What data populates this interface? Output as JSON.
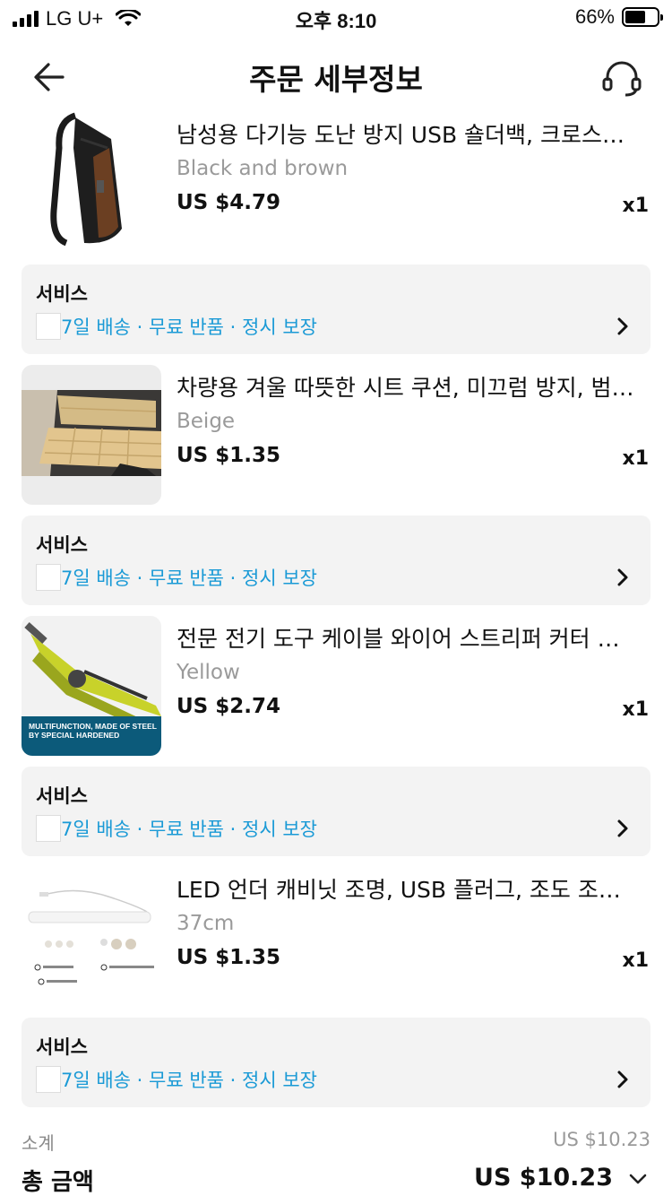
{
  "status_bar": {
    "carrier": "LG U+",
    "time": "오후 8:10",
    "battery_pct": "66%",
    "battery_level": 0.66
  },
  "header": {
    "title": "주문 세부정보",
    "back_icon": "arrow-left-icon",
    "support_icon": "headset-icon"
  },
  "items": [
    {
      "title": "남성용 다기능 도난 방지 USB 숄더백, 크로스바디 백",
      "variant": "Black and brown",
      "price": "US $4.79",
      "qty": "x1"
    },
    {
      "title": "차량용 겨울 따뜻한 시트 쿠션, 미끄럼 방지, 범용 시트",
      "variant": "Beige",
      "price": "US $1.35",
      "qty": "x1"
    },
    {
      "title": "전문 전기 도구 케이블 와이어 스트리퍼 커터 압착기",
      "variant": "Yellow",
      "price": "US $2.74",
      "qty": "x1",
      "image_caption": "MULTIFUNCTION, MADE OF STEEL BY SPECIAL HARDENED"
    },
    {
      "title": "LED 언더 캐비닛 조명, USB 플러그, 조도 조절 가능",
      "variant": "37cm",
      "price": "US $1.35",
      "qty": "x1"
    }
  ],
  "service": {
    "title": "서비스",
    "text": "7일 배송 · 무료 반품 · 정시 보장",
    "chevron_icon": "chevron-right-icon"
  },
  "summary": {
    "subtotal_label": "소계",
    "subtotal_value": "US $10.23",
    "total_label": "총 금액",
    "total_value": "US $10.23",
    "expand_icon": "chevron-down-icon"
  },
  "colors": {
    "accent_link": "#1a9ad6",
    "service_bg": "#f3f3f3",
    "muted_text": "#9a9a9a"
  }
}
